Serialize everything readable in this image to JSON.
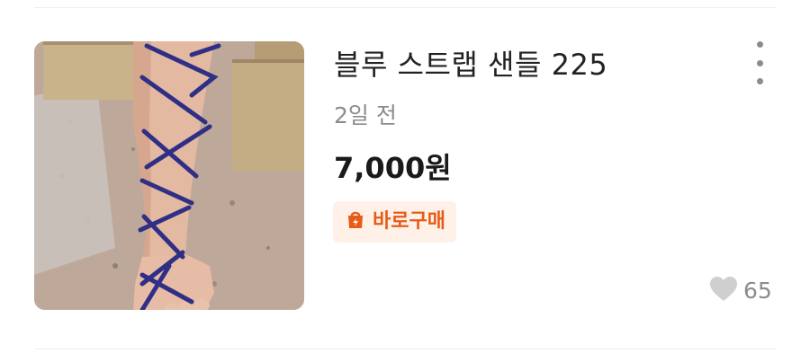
{
  "listing": {
    "title": "블루 스트랩 샌들 225",
    "time_ago": "2일 전",
    "price": "7,000원",
    "badge": {
      "label": "바로구매",
      "icon": "bolt-bag-icon",
      "color": "#e65c19",
      "background": "#fff1e8"
    },
    "more_icon": "more-vertical-icon",
    "likes": {
      "icon": "heart-icon",
      "count": "65"
    },
    "thumbnail": {
      "subject": "blue lace-up strap sandal worn on foot"
    }
  }
}
